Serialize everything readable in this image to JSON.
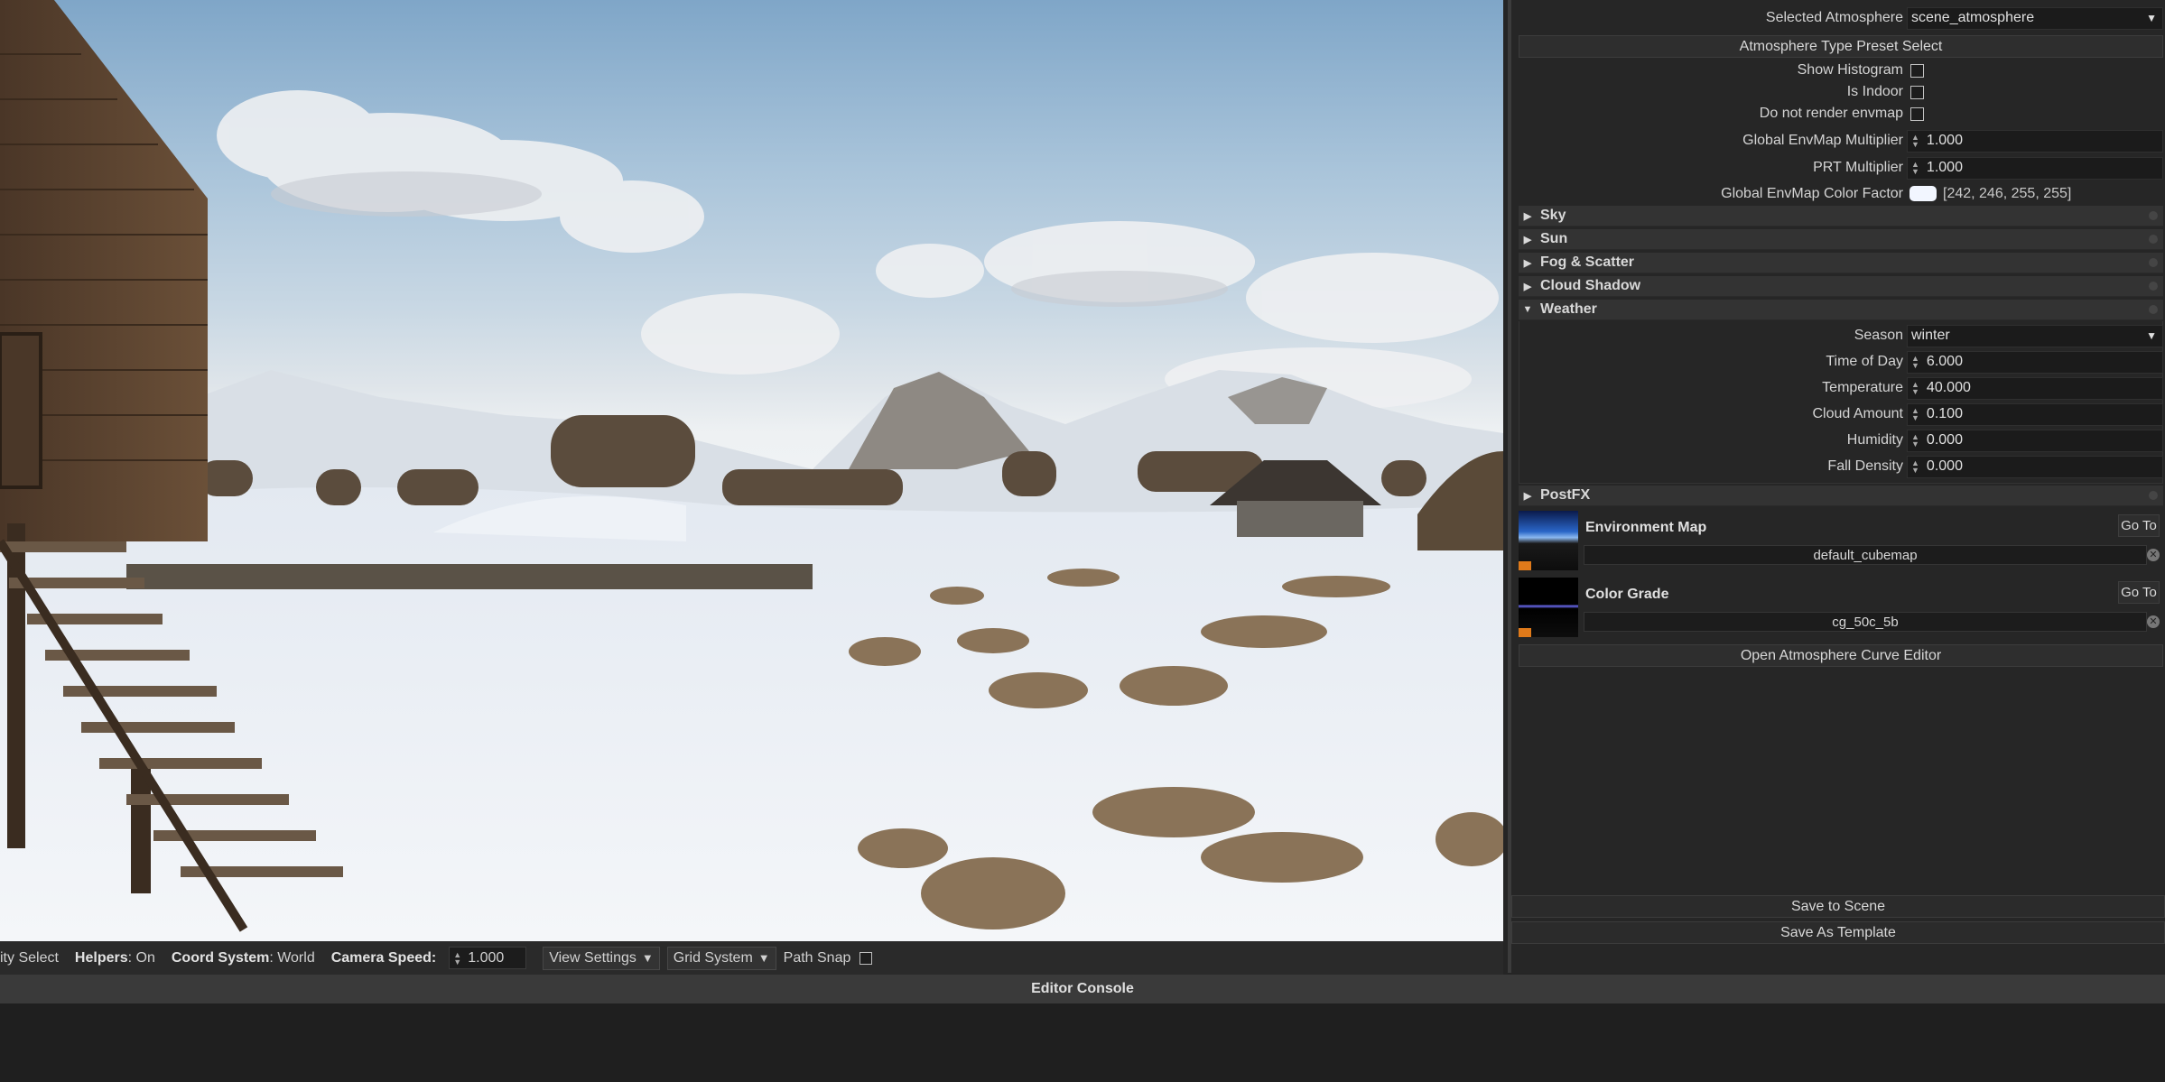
{
  "panel": {
    "selected_atmosphere_label": "Selected Atmosphere",
    "selected_atmosphere_value": "scene_atmosphere",
    "preset_button": "Atmosphere Type Preset Select",
    "show_histogram_label": "Show Histogram",
    "show_histogram_checked": false,
    "is_indoor_label": "Is Indoor",
    "is_indoor_checked": false,
    "no_envmap_label": "Do not render envmap",
    "no_envmap_checked": false,
    "global_envmap_mult_label": "Global EnvMap Multiplier",
    "global_envmap_mult_value": "1.000",
    "prt_mult_label": "PRT Multiplier",
    "prt_mult_value": "1.000",
    "color_factor_label": "Global EnvMap Color Factor",
    "color_factor_value": "[242, 246, 255, 255]",
    "color_factor_swatch": "#f2f6ff",
    "sections": [
      {
        "label": "Sky",
        "expanded": false
      },
      {
        "label": "Sun",
        "expanded": false
      },
      {
        "label": "Fog & Scatter",
        "expanded": false
      },
      {
        "label": "Cloud Shadow",
        "expanded": false
      },
      {
        "label": "Weather",
        "expanded": true
      }
    ],
    "weather": {
      "season_label": "Season",
      "season_value": "winter",
      "time_label": "Time of Day",
      "time_value": "6.000",
      "temperature_label": "Temperature",
      "temperature_value": "40.000",
      "cloud_label": "Cloud Amount",
      "cloud_value": "0.100",
      "humidity_label": "Humidity",
      "humidity_value": "0.000",
      "fall_label": "Fall Density",
      "fall_value": "0.000"
    },
    "postfx_label": "PostFX",
    "env_map": {
      "title": "Environment Map",
      "goto": "Go To",
      "path": "default_cubemap"
    },
    "color_grade": {
      "title": "Color Grade",
      "goto": "Go To",
      "path": "cg_50c_5b"
    },
    "curve_editor_button": "Open Atmosphere Curve Editor",
    "save_scene_button": "Save to Scene",
    "save_template_button": "Save As Template"
  },
  "statusbar": {
    "select_mode": "ity Select",
    "helpers_label": "Helpers",
    "helpers_value": ": On",
    "coord_label": "Coord System",
    "coord_value": ": World",
    "camera_speed_label": "Camera Speed:",
    "camera_speed_value": "1.000",
    "view_settings": "View Settings",
    "grid_system": "Grid System",
    "path_snap_label": "Path Snap",
    "path_snap_checked": false
  },
  "console": {
    "title": "Editor Console"
  }
}
